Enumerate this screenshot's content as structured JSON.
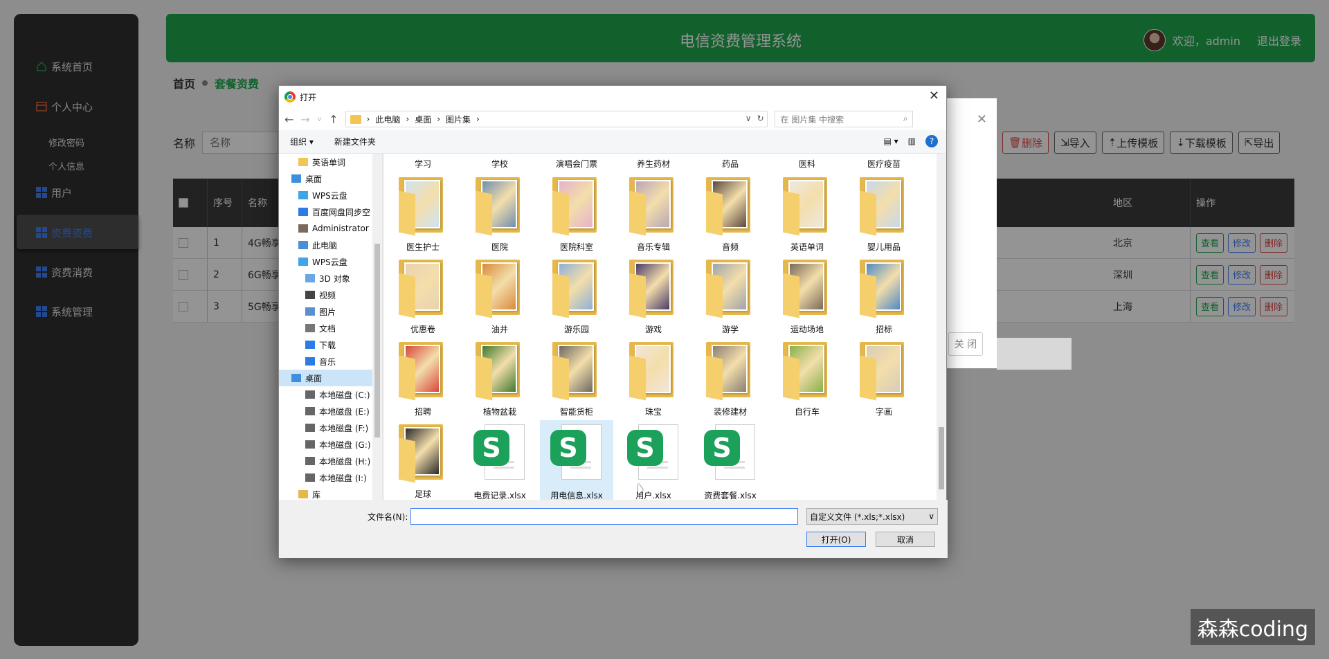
{
  "sidebar": {
    "items": [
      {
        "label": "系统首页",
        "icon": "home-icon"
      },
      {
        "label": "个人中心",
        "icon": "window-icon"
      },
      {
        "label": "修改密码"
      },
      {
        "label": "个人信息"
      },
      {
        "label": "用户",
        "icon": "grid-icon"
      },
      {
        "label": "资费资费",
        "icon": "grid-icon"
      },
      {
        "label": "资费消费",
        "icon": "grid-icon"
      },
      {
        "label": "系统管理",
        "icon": "grid-icon"
      }
    ]
  },
  "header": {
    "title": "电信资费管理系统",
    "welcome": "欢迎，admin",
    "logout": "退出登录"
  },
  "breadcrumb": {
    "home": "首页",
    "current": "套餐资费"
  },
  "search": {
    "label": "名称",
    "placeholder": "名称"
  },
  "toolbar": {
    "delete": "删除",
    "import": "导入",
    "upload_tpl": "上传模板",
    "download_tpl": "下载模板",
    "export": "导出"
  },
  "table": {
    "headers": {
      "index": "序号",
      "name": "名称",
      "region": "地区",
      "ops": "操作"
    },
    "rows": [
      {
        "index": "1",
        "name": "4G畅享",
        "region": "北京"
      },
      {
        "index": "2",
        "name": "6G畅享",
        "region": "深圳"
      },
      {
        "index": "3",
        "name": "5G畅享",
        "region": "上海"
      }
    ],
    "actions": {
      "view": "查看",
      "edit": "修改",
      "delete": "删除"
    }
  },
  "modal": {
    "close": "关 闭"
  },
  "dialog": {
    "title": "打开",
    "path": [
      "此电脑",
      "桌面",
      "图片集"
    ],
    "search_placeholder": "在 图片集 中搜索",
    "organize": "组织 ▾",
    "new_folder": "新建文件夹",
    "nav": [
      {
        "label": "英语单词",
        "type": "folder"
      },
      {
        "label": "桌面",
        "type": "desktop"
      },
      {
        "label": "WPS云盘",
        "type": "cloud"
      },
      {
        "label": "百度网盘同步空",
        "type": "baidu"
      },
      {
        "label": "Administrator",
        "type": "user"
      },
      {
        "label": "此电脑",
        "type": "pc"
      },
      {
        "label": "WPS云盘",
        "type": "cloud"
      },
      {
        "label": "3D 对象",
        "type": "3d"
      },
      {
        "label": "视频",
        "type": "video"
      },
      {
        "label": "图片",
        "type": "picture"
      },
      {
        "label": "文档",
        "type": "doc"
      },
      {
        "label": "下载",
        "type": "download"
      },
      {
        "label": "音乐",
        "type": "music"
      },
      {
        "label": "桌面",
        "type": "desktop",
        "selected": true
      },
      {
        "label": "本地磁盘 (C:)",
        "type": "drive"
      },
      {
        "label": "本地磁盘 (E:)",
        "type": "drive"
      },
      {
        "label": "本地磁盘 (F:)",
        "type": "drive"
      },
      {
        "label": "本地磁盘 (G:)",
        "type": "drive"
      },
      {
        "label": "本地磁盘 (H:)",
        "type": "drive"
      },
      {
        "label": "本地磁盘 (I:)",
        "type": "drive"
      },
      {
        "label": "库",
        "type": "library"
      }
    ],
    "top_partial": [
      "学习",
      "学校",
      "演唱会门票",
      "养生药材",
      "药品",
      "医科",
      "医疗疫苗"
    ],
    "folders": [
      {
        "label": "医生护士",
        "color": "#cfe3f2"
      },
      {
        "label": "医院",
        "color": "#6f8fb0"
      },
      {
        "label": "医院科室",
        "color": "#e6b3c9"
      },
      {
        "label": "音乐专辑",
        "color": "#b9a7b6"
      },
      {
        "label": "音频",
        "color": "#5b4a40"
      },
      {
        "label": "英语单词",
        "color": "#efe8e0"
      },
      {
        "label": "婴儿用品",
        "color": "#c8d9ea"
      },
      {
        "label": "优惠卷",
        "color": "#e9d3b0"
      },
      {
        "label": "油井",
        "color": "#d98a3a"
      },
      {
        "label": "游乐园",
        "color": "#8fb0d6"
      },
      {
        "label": "游戏",
        "color": "#4a3a6a"
      },
      {
        "label": "游学",
        "color": "#a0a4a8"
      },
      {
        "label": "运动场地",
        "color": "#7a6a5a"
      },
      {
        "label": "招标",
        "color": "#4f8ac4"
      },
      {
        "label": "招聘",
        "color": "#d8473a"
      },
      {
        "label": "植物盆栽",
        "color": "#3e7a2c"
      },
      {
        "label": "智能货柜",
        "color": "#6e6a60"
      },
      {
        "label": "珠宝",
        "color": "#f2e6d8"
      },
      {
        "label": "装修建材",
        "color": "#8a7f74"
      },
      {
        "label": "自行车",
        "color": "#8ab04a"
      },
      {
        "label": "字画",
        "color": "#d8cdb6"
      },
      {
        "label": "足球",
        "color": "#2a2a2a"
      }
    ],
    "xlsx_files": [
      "电费记录.xlsx",
      "用电信息.xlsx",
      "用户.xlsx",
      "资费套餐.xlsx"
    ],
    "filename_label": "文件名(N):",
    "filetype": "自定义文件 (*.xls;*.xlsx)",
    "open": "打开(O)",
    "cancel": "取消"
  },
  "watermark": "森森coding"
}
